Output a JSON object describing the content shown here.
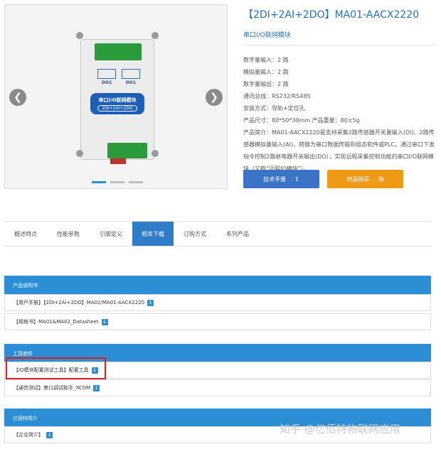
{
  "gallery": {
    "prev_icon": "chevron-left-icon",
    "next_icon": "chevron-right-icon",
    "device": {
      "relay_labels": [
        "DO2",
        "DO1"
      ],
      "label_line1": "串口I/O联网模块",
      "label_line2": "2DI+2AI+2DO"
    },
    "slides": 3,
    "active_slide": 0
  },
  "product": {
    "title": "【2DI+2AI+2DO】MA01-AACX2220",
    "subtitle": "串口I/O联网模块",
    "specs": [
      "数字量输入：2 路",
      "模拟量输入：2 路",
      "数字量输出：2 路",
      "通讯总线：RS232/RS485",
      "安装方式：导轨+定位孔",
      "产品尺寸：80*50*30mm 产品重量：80±5g"
    ],
    "description": "产品简介：MA01-AACX2220是支持采集2路传感器开关量输入(DI)、2路传感器模拟量输入(AI)，转换为串口数据传输到组态软件或PLC。通过串口下发指令控制2路继电器开关输出(DO），实现远程采集控制功能的串口I/O联网模块（又称“远程IO模块”）。",
    "manual_button": "技术手册",
    "buy_button": "样品购买"
  },
  "tabs": [
    "概述特点",
    "性能参数",
    "引脚定义",
    "相关下载",
    "订购方式",
    "系列产品"
  ],
  "active_tab": "相关下载",
  "sections": {
    "manual": {
      "title": "产品说明书",
      "rows": [
        "【用户手册】【2DI+2AI+2DO】MA02/MA01-AACX2220",
        "【规格书】MA01&MA02_Datasheet"
      ]
    },
    "tools": {
      "title": "工具软件",
      "rows": [
        "【IO模块配置测试工具】配置工具",
        "【通信测试】串口调试助手_XCOM"
      ]
    },
    "company": {
      "title": "亿佰特简介",
      "rows": [
        "【企业简介】"
      ]
    }
  },
  "watermark": "知乎 @亿佰特物联网应用"
}
